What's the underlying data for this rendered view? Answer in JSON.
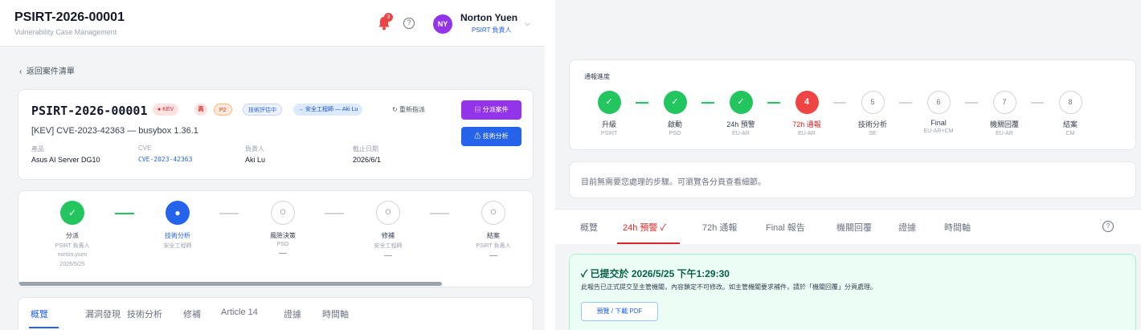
{
  "header": {
    "title": "PSIRT-2026-00001",
    "subtitle": "Vulnerability Case Management",
    "notification_count": "3",
    "help_symbol": "?",
    "user_initials": "NY",
    "user_name": "Norton Yuen",
    "user_role": "PSIRT 負責人"
  },
  "left": {
    "back_label": "返回案件清單",
    "case": {
      "id": "PSIRT-2026-00001",
      "badges": {
        "kev": "KEV",
        "severity": "高",
        "priority": "P2",
        "stage": "技術評估中",
        "assignee": "→ 安全工程師 — Aki Lu"
      },
      "reload_label": "↻ 重新指派",
      "title": "[KEV] CVE-2023-42363 — busybox 1.36.1",
      "fields": [
        {
          "label": "產品",
          "value": "Asus AI Server DG10"
        },
        {
          "label": "CVE",
          "value": "CVE-2023-42363"
        },
        {
          "label": "負責人",
          "value": "Aki Lu"
        },
        {
          "label": "截止日期",
          "value": "2026/6/1"
        }
      ],
      "primary_button": "▤ 分派案件",
      "secondary_button": "⚠ 技術分析"
    },
    "workflow": [
      {
        "label": "分派",
        "role": "PSIRT 負責人",
        "meta1": "norton.yuen",
        "meta2": "2026/5/25",
        "state": "done",
        "symbol": "✓"
      },
      {
        "label": "技術分析",
        "role": "安全工程師",
        "state": "current",
        "symbol": "●"
      },
      {
        "label": "風險決策",
        "role": "PSO",
        "dash": "—",
        "state": "todo",
        "symbol": "O"
      },
      {
        "label": "修補",
        "role": "安全工程師",
        "dash": "—",
        "state": "todo",
        "symbol": "O"
      },
      {
        "label": "結案",
        "role": "PSIRT 負責人",
        "dash": "—",
        "state": "todo",
        "symbol": "O"
      }
    ],
    "tabs": [
      "概覽",
      "漏洞發現",
      "技術分析",
      "修補",
      "Article 14",
      "證據",
      "時間軸"
    ]
  },
  "right": {
    "progress_title": "通報進度",
    "steps": [
      {
        "label": "升級",
        "role": "PSIRT",
        "state": "done",
        "symbol": "✓"
      },
      {
        "label": "啟動",
        "role": "PSO",
        "state": "done",
        "symbol": "✓"
      },
      {
        "label": "24h 預警",
        "role": "EU-AR",
        "state": "done",
        "symbol": "✓"
      },
      {
        "label": "72h 通報",
        "role": "EU-AR",
        "state": "warn",
        "symbol": "4"
      },
      {
        "label": "技術分析",
        "role": "SE",
        "state": "todo",
        "symbol": "5"
      },
      {
        "label": "Final",
        "role": "EU-AR+CM",
        "state": "todo",
        "symbol": "6"
      },
      {
        "label": "機關回覆",
        "role": "EU-AR",
        "state": "todo",
        "symbol": "7"
      },
      {
        "label": "結案",
        "role": "CM",
        "state": "todo",
        "symbol": "8"
      }
    ],
    "notice": "目前無需要您處理的步驟。可瀏覽各分頁查看細節。",
    "tabs": [
      "概覽",
      "24h 預警 ✓",
      "72h 通報",
      "Final 報告",
      "機關回覆",
      "證據",
      "時間軸"
    ],
    "help_symbol": "?",
    "success": {
      "title": "✓ 已提交於 2026/5/25 下午1:29:30",
      "body": "此報告已正式提交至主管機關，內容鎖定不可修改。如主管機關要求補件，請於「機關回覆」分頁處理。",
      "pdf_button": "預覽 / 下載 PDF"
    }
  },
  "colors": {
    "done": "#22c55e",
    "current": "#2563eb",
    "warn": "#ef4444",
    "purple": "#9333ea"
  }
}
